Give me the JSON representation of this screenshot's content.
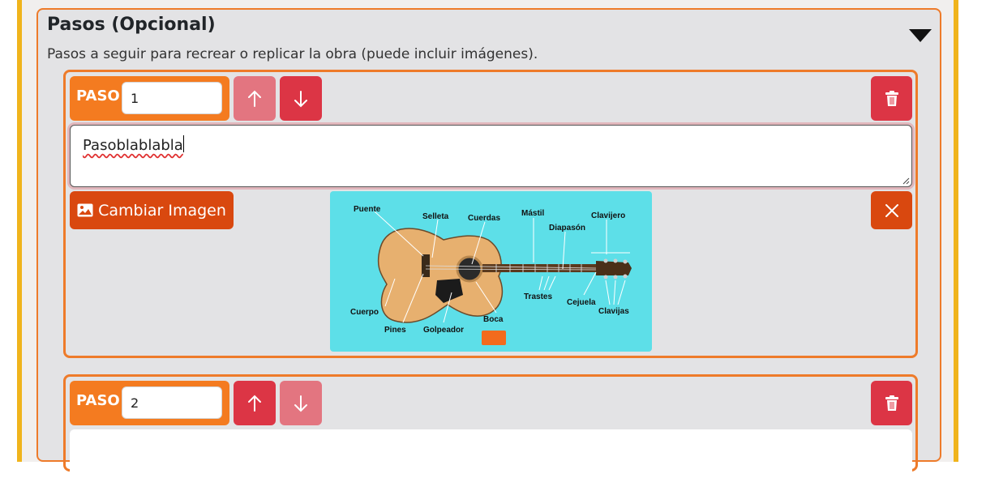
{
  "section": {
    "title": "Pasos (Opcional)",
    "subtitle": "Pasos a seguir para recrear o replicar la obra (puede incluir imágenes)."
  },
  "steps": [
    {
      "label": "PASO",
      "number": "1",
      "text": "Pasoblablabla",
      "change_image_label": "Cambiar Imagen",
      "image_labels": {
        "puente": "Puente",
        "selleta": "Selleta",
        "cuerdas": "Cuerdas",
        "mastil": "Mástil",
        "clavijero": "Clavijero",
        "diapason": "Diapasón",
        "cuerpo": "Cuerpo",
        "pines": "Pines",
        "golpeador": "Golpeador",
        "boca": "Boca",
        "trastes": "Trastes",
        "cejuela": "Cejuela",
        "clavijas": "Clavijas"
      }
    },
    {
      "label": "PASO",
      "number": "2"
    }
  ],
  "colors": {
    "orange": "#f47b20",
    "red": "#dc3545",
    "dark_orange": "#d9480f",
    "gold": "#f0b41c"
  }
}
